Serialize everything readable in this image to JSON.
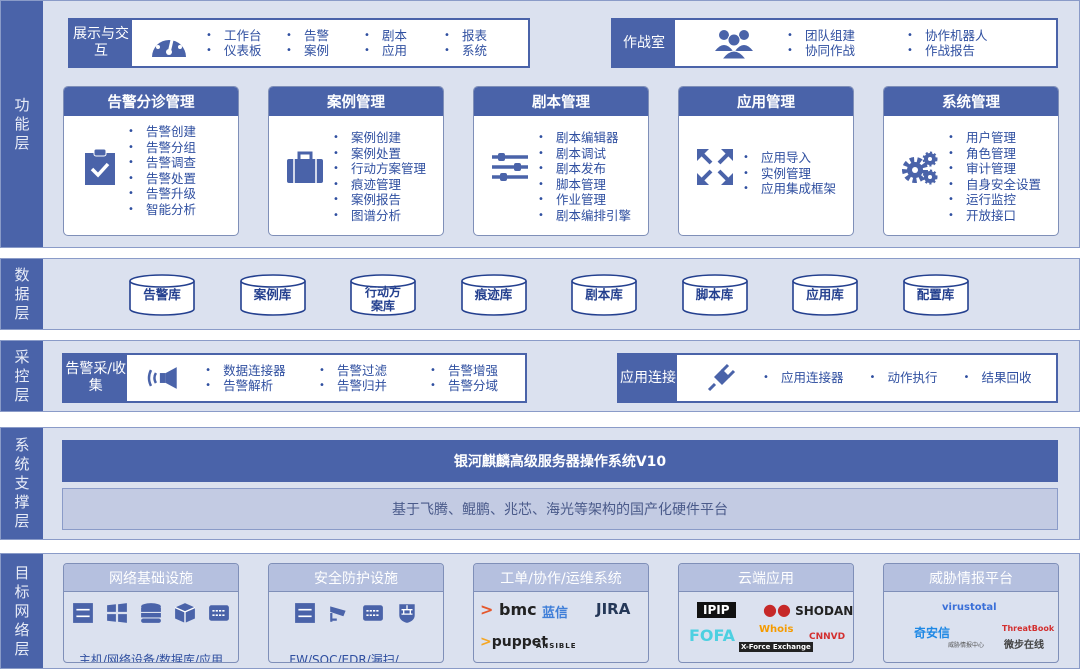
{
  "layers": {
    "function": "功能层",
    "data": "数据层",
    "control": "采控层",
    "support": "系统支撑层",
    "target": "目标网络层"
  },
  "display": {
    "title": "展示与交互",
    "icon": "dashboard-icon",
    "items": [
      [
        "工作台",
        "仪表板"
      ],
      [
        "告警",
        "案例"
      ],
      [
        "剧本",
        "应用"
      ],
      [
        "报表",
        "系统"
      ]
    ]
  },
  "warroom": {
    "title": "作战室",
    "icon": "team-icon",
    "items": [
      [
        "团队组建",
        "协同作战"
      ],
      [
        "协作机器人",
        "作战报告"
      ]
    ]
  },
  "modules": [
    {
      "title": "告警分诊管理",
      "icon": "clipboard-check-icon",
      "items": [
        "告警创建",
        "告警分组",
        "告警调查",
        "告警处置",
        "告警升级",
        "智能分析"
      ]
    },
    {
      "title": "案例管理",
      "icon": "briefcase-icon",
      "items": [
        "案例创建",
        "案例处置",
        "行动方案管理",
        "痕迹管理",
        "案例报告",
        "图谱分析"
      ]
    },
    {
      "title": "剧本管理",
      "icon": "sliders-icon",
      "items": [
        "剧本编辑器",
        "剧本调试",
        "剧本发布",
        "脚本管理",
        "作业管理",
        "剧本编排引擎"
      ]
    },
    {
      "title": "应用管理",
      "icon": "expand-arrows-icon",
      "items": [
        "应用导入",
        "实例管理",
        "应用集成框架"
      ]
    },
    {
      "title": "系统管理",
      "icon": "gears-icon",
      "items": [
        "用户管理",
        "角色管理",
        "审计管理",
        "自身安全设置",
        "运行监控",
        "开放接口"
      ]
    }
  ],
  "databases": [
    "告警库",
    "案例库",
    "行动方案库",
    "痕迹库",
    "剧本库",
    "脚本库",
    "应用库",
    "配置库"
  ],
  "collect": {
    "title": "告警采/收集",
    "icon": "signal-horn-icon",
    "items": [
      [
        "数据连接器",
        "告警解析"
      ],
      [
        "告警过滤",
        "告警归并"
      ],
      [
        "告警增强",
        "告警分域"
      ]
    ]
  },
  "connect": {
    "title": "应用连接",
    "icon": "plug-icon",
    "items": [
      "应用连接器",
      "动作执行",
      "结果回收"
    ]
  },
  "support": {
    "os": "银河麒麟高级服务器操作系统V10",
    "hw": "基于飞腾、鲲鹏、兆芯、海光等架构的国产化硬件平台"
  },
  "targets": [
    {
      "title": "网络基础设施",
      "caption": "主机/网络设备/数据库/应用",
      "icons": [
        "server-icon",
        "windows-icon",
        "database-icon",
        "cube-icon",
        "switch-icon"
      ]
    },
    {
      "title": "安全防护设施",
      "caption": "FW/SOC/EDR/漏扫/……",
      "icons": [
        "server-icon",
        "camera-icon",
        "switch-icon",
        "firewall-icon"
      ]
    },
    {
      "title": "工单/协作/运维系统",
      "logos": [
        "bmc",
        "蓝信",
        "JIRA",
        "puppet",
        "ANSIBLE"
      ]
    },
    {
      "title": "云端应用",
      "logos": [
        "IPIP",
        "SHODAN",
        "FOFA",
        "Whois",
        "X-Force Exchange",
        "CNNVD"
      ]
    },
    {
      "title": "威胁情报平台",
      "logos": [
        "virustotal",
        "奇安信",
        "威胁情报中心",
        "ThreatBook",
        "微步在线"
      ]
    }
  ],
  "colors": {
    "primary": "#4a63a9",
    "background": "#dbe1ef",
    "text": "#2f4fa0"
  }
}
